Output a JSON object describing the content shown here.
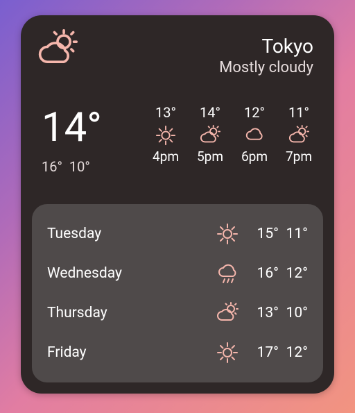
{
  "location": {
    "city": "Tokyo",
    "condition": "Mostly cloudy"
  },
  "current": {
    "temp": "14°",
    "high": "16°",
    "low": "10°",
    "icon": "partly-cloudy"
  },
  "hourly": [
    {
      "temp": "13°",
      "icon": "sunny",
      "time": "4pm"
    },
    {
      "temp": "14°",
      "icon": "partly-cloudy",
      "time": "5pm"
    },
    {
      "temp": "12°",
      "icon": "cloudy",
      "time": "6pm"
    },
    {
      "temp": "11°",
      "icon": "partly-cloudy",
      "time": "7pm"
    }
  ],
  "daily": [
    {
      "name": "Tuesday",
      "icon": "sunny",
      "high": "15°",
      "low": "11°"
    },
    {
      "name": "Wednesday",
      "icon": "rain",
      "high": "16°",
      "low": "12°"
    },
    {
      "name": "Thursday",
      "icon": "partly-cloudy",
      "high": "13°",
      "low": "10°"
    },
    {
      "name": "Friday",
      "icon": "sunny",
      "high": "17°",
      "low": "12°"
    }
  ],
  "colors": {
    "accent": "#f5b6ac",
    "panel": "#2e2727",
    "sub": "#4f4a4a"
  }
}
